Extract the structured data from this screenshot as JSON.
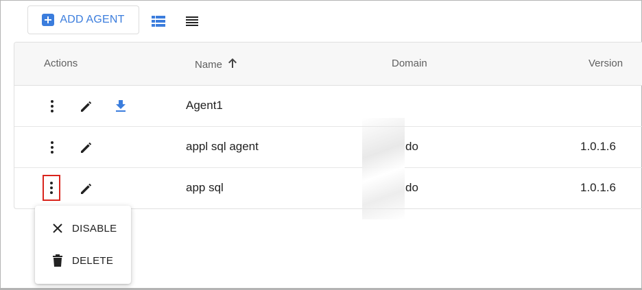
{
  "toolbar": {
    "add_agent_label": "ADD AGENT",
    "add_icon": "plus-box-icon",
    "views": [
      "list-view-icon",
      "compact-list-icon"
    ]
  },
  "table": {
    "columns": {
      "actions": "Actions",
      "name": "Name",
      "domain": "Domain",
      "version": "Version"
    },
    "sort": {
      "column": "Name",
      "direction": "ascending"
    },
    "rows": [
      {
        "name": "Agent1",
        "domain": "",
        "version": ""
      },
      {
        "name": "appl sql agent",
        "domain": "do",
        "version": "1.0.1.6"
      },
      {
        "name": "app sql",
        "domain": "do",
        "version": "1.0.1.6"
      }
    ]
  },
  "context_menu": {
    "items": [
      {
        "label": "DISABLE",
        "icon": "close-icon"
      },
      {
        "label": "DELETE",
        "icon": "trash-icon"
      }
    ]
  },
  "colors": {
    "accent": "#3b7ddd",
    "highlight": "#d9241c"
  }
}
